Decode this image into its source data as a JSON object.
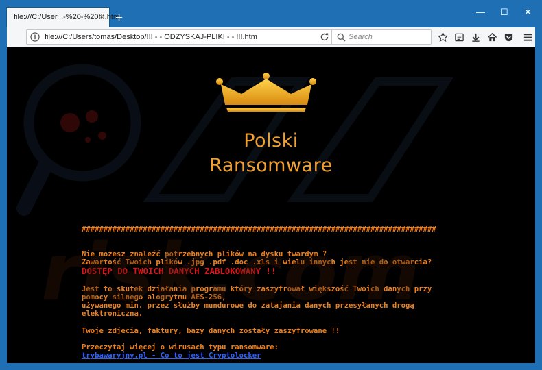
{
  "tab": {
    "title": "file:///C:/User...-%20-%20!!!.htm",
    "close": "×"
  },
  "new_tab": "+",
  "window_controls": {
    "minimize": "—",
    "maximize": "☐",
    "close": "✕"
  },
  "address": {
    "url": "file:///C:/Users/tomas/Desktop/!!! - - ODZYSKAJ-PLIKI - - !!!.htm"
  },
  "search": {
    "placeholder": "Search"
  },
  "icons": [
    "info-icon",
    "reload-icon",
    "search-icon",
    "bookmark-star-icon",
    "reader-list-icon",
    "download-icon",
    "home-icon",
    "pocket-icon",
    "menu-icon"
  ],
  "page": {
    "brand_line1": "Polski",
    "brand_line2": "Ransomware",
    "separator": "#################################################################################",
    "l1": "Nie możesz znaleźć potrzebnych plików na dysku twardym ?",
    "l2": "Zawartość Twoich plików .jpg .pdf .doc .xls i wielu innych jest nie do otwarcia?",
    "l3": "DOSTĘP DO TWOICH DANYCH ZABLOKOWANY !!",
    "l4": "Jest to skutek działania programu który zaszyfrował większość Twoich danych przy",
    "l5": "pomocy silnego alogrytmu AES-256,",
    "l6": "używanego min. przez służby mundurowe do zatajania danych przesyłanych drogą",
    "l7": "elektroniczną.",
    "l8": "Twoje zdjecia, faktury, bazy danych zostały zaszyfrowane !!",
    "l9": "Przeczytaj więcej o wirusach typu ransomware:",
    "link": "trybawaryjny.pl - Co to jest Cryptolocker"
  },
  "watermark_text": "risk.com",
  "colors": {
    "accent": "#ee7f1b",
    "alert": "#e1141b",
    "link": "#2f61ff",
    "crown": "#f5b51d"
  }
}
